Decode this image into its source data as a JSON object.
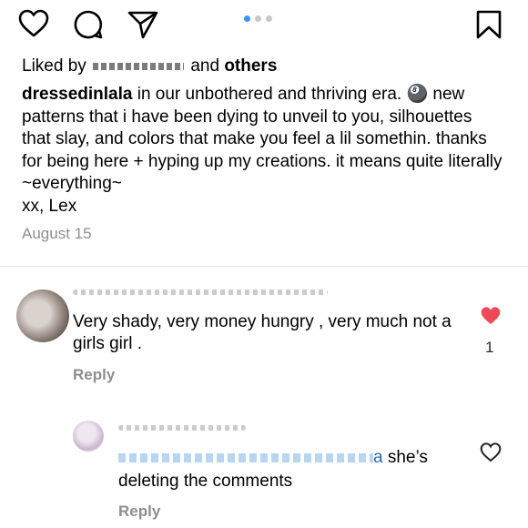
{
  "pager": {
    "count": 3,
    "active": 0
  },
  "liked": {
    "prefix": "Liked by",
    "and": "and",
    "others": "others"
  },
  "caption": {
    "username": "dressedinlala",
    "text": " in our unbothered and thriving era. 🎱 new patterns that i have been dying to unveil to you, silhouettes that slay, and colors that make you feel a lil somethin. thanks for being here + hyping up my creations. it means quite literally ~everything~",
    "signoff": "xx, Lex"
  },
  "date": "August 15",
  "comments": [
    {
      "text": "Very shady, very money hungry , very much not a girls girl .",
      "reply": "Reply",
      "likes": "1",
      "liked": true
    },
    {
      "mention_suffix": "a",
      "text": " she’s deleting the comments",
      "reply": "Reply",
      "liked": false
    }
  ],
  "colors": {
    "like_red": "#ed4956",
    "accent": "#3897f0",
    "muted": "#8e8e8e"
  }
}
